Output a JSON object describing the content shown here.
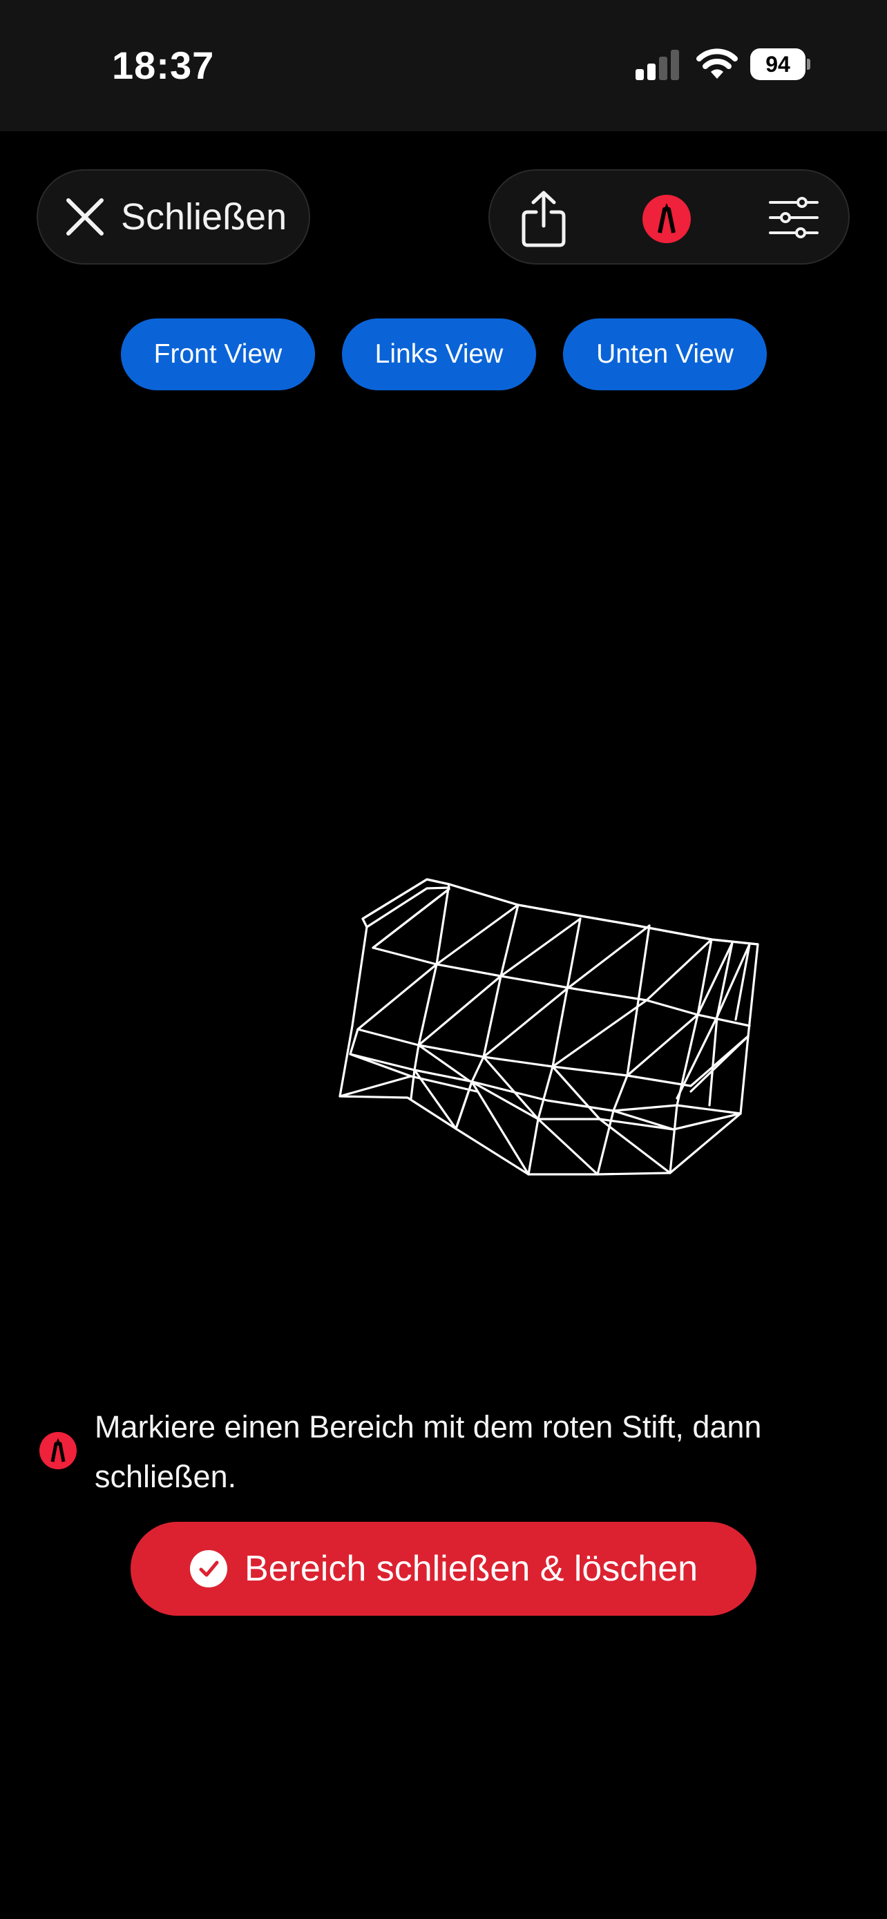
{
  "status_bar": {
    "time": "18:37",
    "battery": "94",
    "icons": [
      "cellular-signal-icon",
      "wifi-icon",
      "battery-icon"
    ]
  },
  "toolbar": {
    "close_label": "Schließen",
    "icons": [
      "close-icon",
      "share-icon",
      "pen-icon",
      "sliders-icon"
    ]
  },
  "views": {
    "front": "Front View",
    "left": "Links View",
    "bottom": "Unten View"
  },
  "hint": {
    "text": "Markiere einen Bereich mit dem roten Stift, dann schließen."
  },
  "action": {
    "label": "Bereich schließen & löschen",
    "icon": "checkmark-circle-icon"
  },
  "colors": {
    "accent_blue": "#0a64d8",
    "accent_red": "#dc2231",
    "pen_red": "#f0213a",
    "background": "#000000",
    "pill_background": "#141414"
  }
}
